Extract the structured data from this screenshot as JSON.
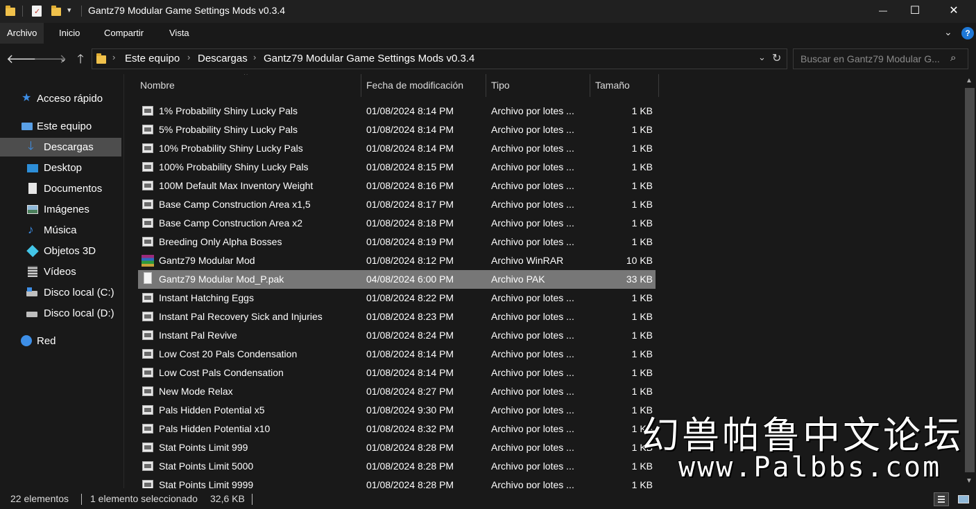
{
  "window": {
    "title": "Gantz79 Modular Game Settings Mods v0.3.4",
    "minimize": "—",
    "maximize": "☐",
    "close": "✕"
  },
  "ribbon": {
    "tabs": [
      "Archivo",
      "Inicio",
      "Compartir",
      "Vista"
    ],
    "active_tab": "Archivo",
    "help": "?"
  },
  "address": {
    "crumbs": [
      "Este equipo",
      "Descargas",
      "Gantz79 Modular Game Settings Mods v0.3.4"
    ],
    "search_placeholder": "Buscar en Gantz79 Modular G..."
  },
  "sidebar": {
    "items": [
      {
        "label": "Acceso rápido",
        "icon": "star-icon"
      },
      {
        "label": "Este equipo",
        "icon": "computer-icon"
      },
      {
        "label": "Descargas",
        "icon": "download-icon",
        "selected": true
      },
      {
        "label": "Desktop",
        "icon": "desktop-icon"
      },
      {
        "label": "Documentos",
        "icon": "documents-icon"
      },
      {
        "label": "Imágenes",
        "icon": "pictures-icon"
      },
      {
        "label": "Música",
        "icon": "music-icon"
      },
      {
        "label": "Objetos 3D",
        "icon": "objects-3d-icon"
      },
      {
        "label": "Vídeos",
        "icon": "videos-icon"
      },
      {
        "label": "Disco local (C:)",
        "icon": "drive-c-icon"
      },
      {
        "label": "Disco local (D:)",
        "icon": "drive-d-icon"
      },
      {
        "label": "Red",
        "icon": "network-icon"
      }
    ]
  },
  "columns": {
    "name": "Nombre",
    "date": "Fecha de modificación",
    "type": "Tipo",
    "size": "Tamaño"
  },
  "files": [
    {
      "name": "1% Probability Shiny Lucky Pals",
      "date": "01/08/2024 8:14 PM",
      "type": "Archivo por lotes ...",
      "size": "1 KB",
      "icon": "batch-file-icon"
    },
    {
      "name": "5% Probability Shiny Lucky Pals",
      "date": "01/08/2024 8:14 PM",
      "type": "Archivo por lotes ...",
      "size": "1 KB",
      "icon": "batch-file-icon"
    },
    {
      "name": "10% Probability Shiny Lucky Pals",
      "date": "01/08/2024 8:14 PM",
      "type": "Archivo por lotes ...",
      "size": "1 KB",
      "icon": "batch-file-icon"
    },
    {
      "name": "100% Probability Shiny Lucky Pals",
      "date": "01/08/2024 8:15 PM",
      "type": "Archivo por lotes ...",
      "size": "1 KB",
      "icon": "batch-file-icon"
    },
    {
      "name": "100M Default Max Inventory Weight",
      "date": "01/08/2024 8:16 PM",
      "type": "Archivo por lotes ...",
      "size": "1 KB",
      "icon": "batch-file-icon"
    },
    {
      "name": "Base Camp Construction Area x1,5",
      "date": "01/08/2024 8:17 PM",
      "type": "Archivo por lotes ...",
      "size": "1 KB",
      "icon": "batch-file-icon"
    },
    {
      "name": "Base Camp Construction Area x2",
      "date": "01/08/2024 8:18 PM",
      "type": "Archivo por lotes ...",
      "size": "1 KB",
      "icon": "batch-file-icon"
    },
    {
      "name": "Breeding Only Alpha Bosses",
      "date": "01/08/2024 8:19 PM",
      "type": "Archivo por lotes ...",
      "size": "1 KB",
      "icon": "batch-file-icon"
    },
    {
      "name": "Gantz79 Modular Mod",
      "date": "01/08/2024 8:12 PM",
      "type": "Archivo WinRAR",
      "size": "10 KB",
      "icon": "winrar-icon"
    },
    {
      "name": "Gantz79 Modular Mod_P.pak",
      "date": "04/08/2024 6:00 PM",
      "type": "Archivo PAK",
      "size": "33 KB",
      "icon": "pak-file-icon",
      "selected": true
    },
    {
      "name": "Instant Hatching Eggs",
      "date": "01/08/2024 8:22 PM",
      "type": "Archivo por lotes ...",
      "size": "1 KB",
      "icon": "batch-file-icon"
    },
    {
      "name": "Instant Pal Recovery Sick and Injuries",
      "date": "01/08/2024 8:23 PM",
      "type": "Archivo por lotes ...",
      "size": "1 KB",
      "icon": "batch-file-icon"
    },
    {
      "name": "Instant Pal Revive",
      "date": "01/08/2024 8:24 PM",
      "type": "Archivo por lotes ...",
      "size": "1 KB",
      "icon": "batch-file-icon"
    },
    {
      "name": "Low Cost 20 Pals Condensation",
      "date": "01/08/2024 8:14 PM",
      "type": "Archivo por lotes ...",
      "size": "1 KB",
      "icon": "batch-file-icon"
    },
    {
      "name": "Low Cost Pals Condensation",
      "date": "01/08/2024 8:14 PM",
      "type": "Archivo por lotes ...",
      "size": "1 KB",
      "icon": "batch-file-icon"
    },
    {
      "name": "New Mode Relax",
      "date": "01/08/2024 8:27 PM",
      "type": "Archivo por lotes ...",
      "size": "1 KB",
      "icon": "batch-file-icon"
    },
    {
      "name": "Pals Hidden Potential x5",
      "date": "01/08/2024 9:30 PM",
      "type": "Archivo por lotes ...",
      "size": "1 KB",
      "icon": "batch-file-icon"
    },
    {
      "name": "Pals Hidden Potential x10",
      "date": "01/08/2024 8:32 PM",
      "type": "Archivo por lotes ...",
      "size": "1 KB",
      "icon": "batch-file-icon"
    },
    {
      "name": "Stat Points Limit 999",
      "date": "01/08/2024 8:28 PM",
      "type": "Archivo por lotes ...",
      "size": "1 KB",
      "icon": "batch-file-icon"
    },
    {
      "name": "Stat Points Limit 5000",
      "date": "01/08/2024 8:28 PM",
      "type": "Archivo por lotes ...",
      "size": "1 KB",
      "icon": "batch-file-icon"
    },
    {
      "name": "Stat Points Limit 9999",
      "date": "01/08/2024 8:28 PM",
      "type": "Archivo por lotes ...",
      "size": "1 KB",
      "icon": "batch-file-icon"
    }
  ],
  "status": {
    "count": "22 elementos",
    "selection": "1 elemento seleccionado",
    "size": "32,6 KB"
  },
  "watermark": {
    "line1": "幻兽帕鲁中文论坛",
    "line2": "www.Palbbs.com"
  },
  "colors": {
    "background": "#191919",
    "selected_row": "#777777",
    "selected_nav": "#4d4d4d",
    "accent": "#0078d7"
  }
}
